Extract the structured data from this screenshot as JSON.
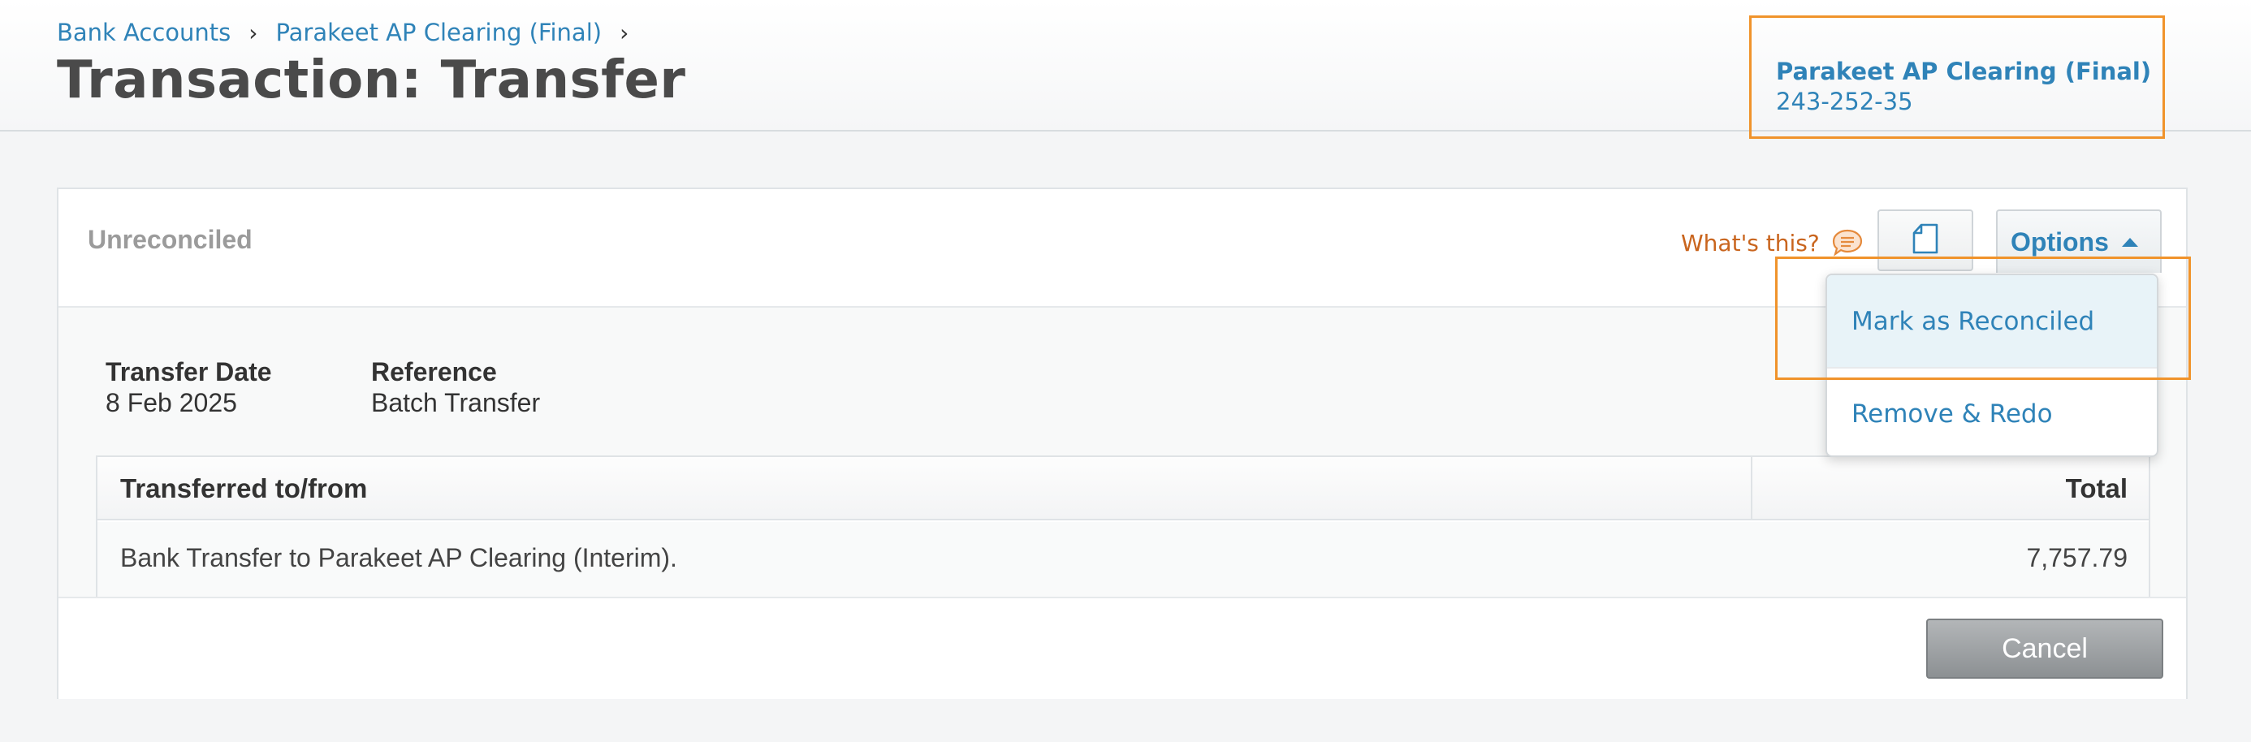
{
  "breadcrumb": {
    "items": [
      {
        "label": "Bank Accounts"
      },
      {
        "label": "Parakeet AP Clearing (Final)"
      }
    ],
    "separator": "›"
  },
  "page": {
    "title": "Transaction: Transfer"
  },
  "account": {
    "name": "Parakeet AP Clearing (Final)",
    "number": "243-252-35"
  },
  "panel": {
    "status": "Unreconciled",
    "whats_this": "What's this?",
    "options_label": "Options",
    "icons": {
      "help": "speech-bubble-icon",
      "copy": "document-icon",
      "caret": "caret-up-icon"
    }
  },
  "details": {
    "date_label": "Transfer Date",
    "date_value": "8 Feb 2025",
    "reference_label": "Reference",
    "reference_value": "Batch Transfer"
  },
  "table": {
    "headers": {
      "description": "Transferred to/from",
      "total": "Total"
    },
    "rows": [
      {
        "description": "Bank Transfer to Parakeet AP Clearing (Interim).",
        "total": "7,757.79"
      }
    ]
  },
  "dropdown": {
    "items": [
      {
        "label": "Mark as Reconciled",
        "highlighted": true
      },
      {
        "label": "Remove & Redo",
        "highlighted": false
      }
    ]
  },
  "footer": {
    "cancel_label": "Cancel"
  },
  "colors": {
    "link": "#2f83b8",
    "highlight_border": "#f0932b",
    "help_text": "#c9651e",
    "title": "#4a4a4a"
  }
}
